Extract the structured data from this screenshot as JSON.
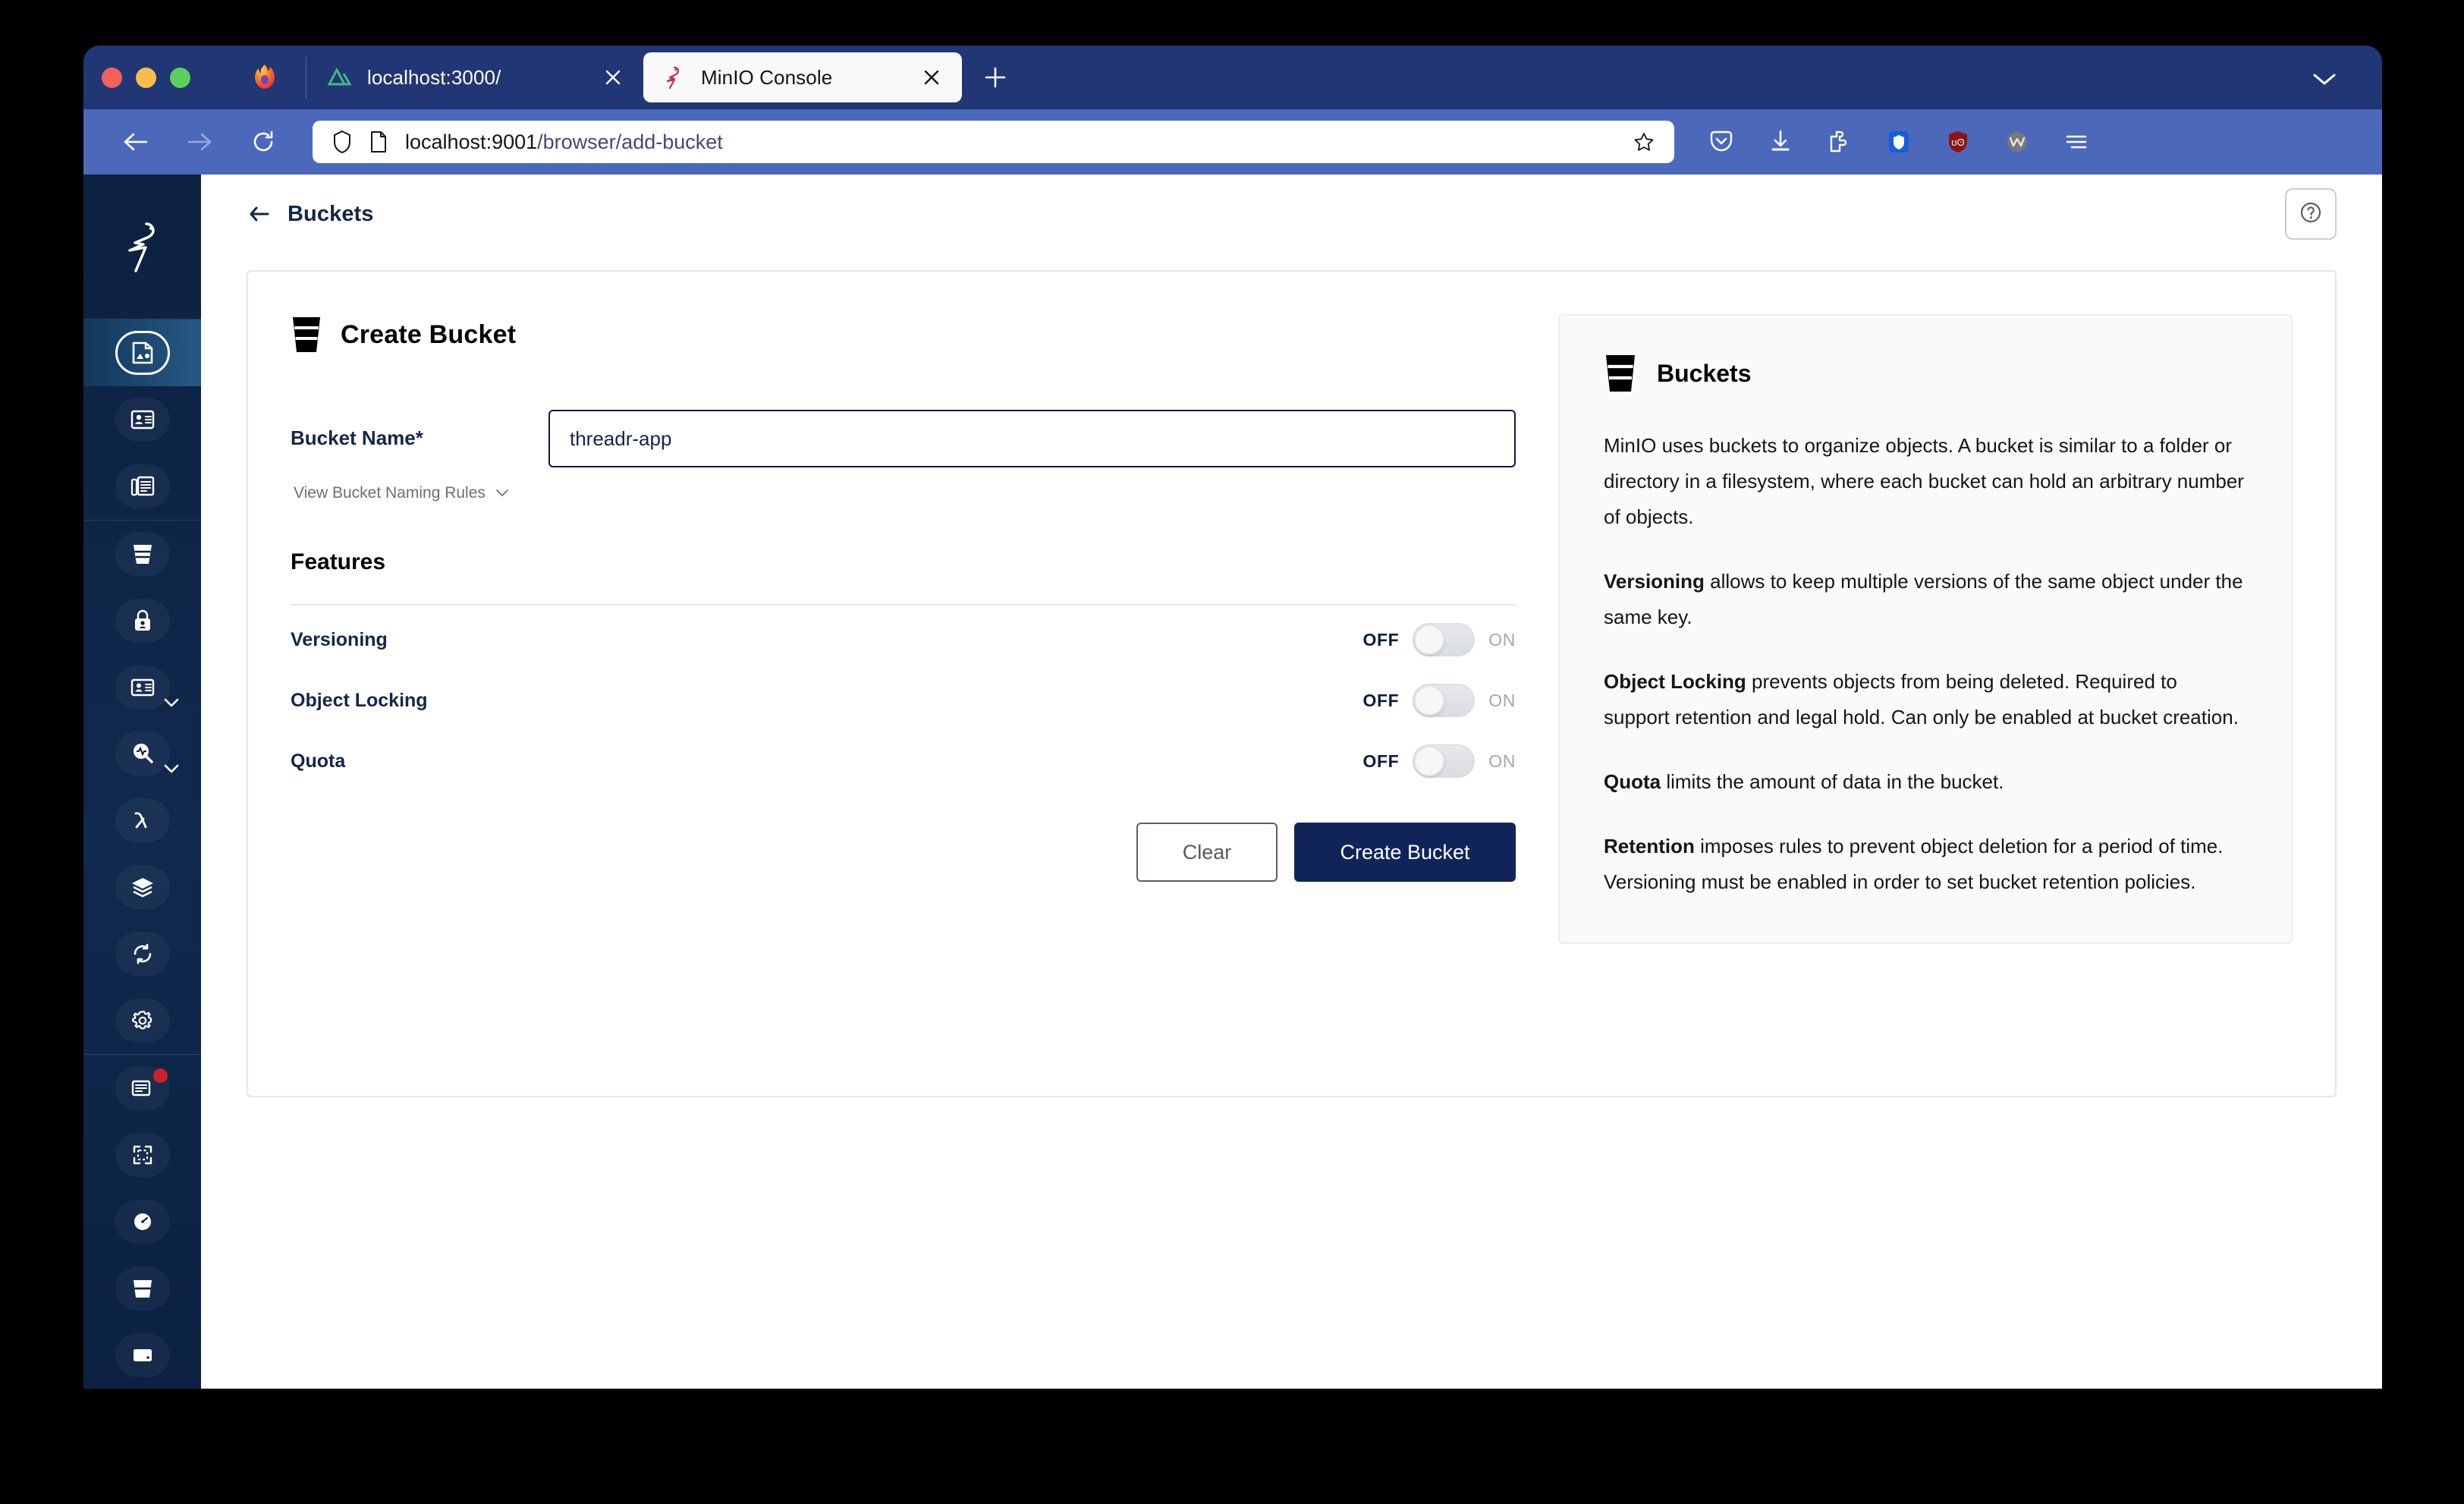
{
  "browser": {
    "app_icon": "firefox-icon",
    "tabs": [
      {
        "favicon": "nuxt-icon",
        "title": "localhost:3000/",
        "active": false
      },
      {
        "favicon": "minio-flamingo-icon",
        "title": "MinIO Console",
        "active": true
      }
    ],
    "new_tab_label": "+",
    "nav": {
      "back": "back-arrow-icon",
      "forward": "forward-arrow-icon",
      "reload": "reload-icon"
    },
    "url": {
      "host": "localhost:9001",
      "path": "/browser/add-bucket",
      "full": "localhost:9001/browser/add-bucket"
    },
    "toolbar_icons": [
      "pocket-icon",
      "downloads-icon",
      "extensions-puzzle-icon",
      "bitwarden-shield-icon",
      "ublock-origin-icon",
      "wallet-avatar-icon",
      "app-menu-icon"
    ]
  },
  "sidebar": {
    "logo": "minio-flamingo-logo",
    "items": [
      {
        "name": "object-browser",
        "icon": "object-browser-icon",
        "active": true,
        "caret": false,
        "badge": false
      },
      {
        "name": "access-keys",
        "icon": "id-card-icon",
        "active": false,
        "caret": false,
        "badge": false
      },
      {
        "name": "documentation",
        "icon": "documents-icon",
        "active": false,
        "caret": false,
        "badge": false
      },
      {
        "name": "buckets",
        "icon": "bucket-icon",
        "active": false,
        "caret": false,
        "badge": false
      },
      {
        "name": "identity",
        "icon": "lock-person-icon",
        "active": false,
        "caret": false,
        "badge": false
      },
      {
        "name": "users",
        "icon": "user-card-icon",
        "active": false,
        "caret": true,
        "badge": false
      },
      {
        "name": "monitoring",
        "icon": "monitoring-icon",
        "active": false,
        "caret": true,
        "badge": false
      },
      {
        "name": "events",
        "icon": "lambda-icon",
        "active": false,
        "caret": false,
        "badge": false
      },
      {
        "name": "tiering",
        "icon": "layers-icon",
        "active": false,
        "caret": false,
        "badge": false
      },
      {
        "name": "replication",
        "icon": "sync-icon",
        "active": false,
        "caret": false,
        "badge": false
      },
      {
        "name": "settings",
        "icon": "gear-icon",
        "active": false,
        "caret": false,
        "badge": false
      },
      {
        "name": "license",
        "icon": "news-icon",
        "active": false,
        "caret": false,
        "badge": true
      },
      {
        "name": "register",
        "icon": "dashed-box-icon",
        "active": false,
        "caret": false,
        "badge": false
      },
      {
        "name": "performance",
        "icon": "speedometer-icon",
        "active": false,
        "caret": false,
        "badge": false
      },
      {
        "name": "bucket-alt",
        "icon": "bucket-icon",
        "active": false,
        "caret": false,
        "badge": false
      },
      {
        "name": "drives",
        "icon": "drive-icon",
        "active": false,
        "caret": false,
        "badge": false
      }
    ]
  },
  "header": {
    "back_label": "Buckets",
    "back_icon": "back-arrow-icon",
    "help_icon": "help-circle-icon"
  },
  "form": {
    "icon": "bucket-icon",
    "title": "Create Bucket",
    "bucket_name_label": "Bucket Name*",
    "bucket_name_value": "threadr-app",
    "bucket_name_placeholder": "",
    "naming_rules_label": "View Bucket Naming Rules",
    "naming_rules_caret": "chevron-down-icon",
    "features_title": "Features",
    "features": [
      {
        "label": "Versioning",
        "off_label": "OFF",
        "on_label": "ON",
        "state": "off"
      },
      {
        "label": "Object Locking",
        "off_label": "OFF",
        "on_label": "ON",
        "state": "off"
      },
      {
        "label": "Quota",
        "off_label": "OFF",
        "on_label": "ON",
        "state": "off"
      }
    ],
    "clear_label": "Clear",
    "create_label": "Create Bucket"
  },
  "info_panel": {
    "icon": "bucket-icon",
    "title": "Buckets",
    "paragraphs": [
      {
        "bold": "",
        "text": "MinIO uses buckets to organize objects. A bucket is similar to a folder or directory in a filesystem, where each bucket can hold an arbitrary number of objects."
      },
      {
        "bold": "Versioning",
        "text": " allows to keep multiple versions of the same object under the same key."
      },
      {
        "bold": "Object Locking",
        "text": " prevents objects from being deleted. Required to support retention and legal hold. Can only be enabled at bucket creation."
      },
      {
        "bold": "Quota",
        "text": " limits the amount of data in the bucket."
      },
      {
        "bold": "Retention",
        "text": " imposes rules to prevent object deletion for a period of time. Versioning must be enabled in order to set bucket retention policies."
      }
    ]
  },
  "colors": {
    "window_chrome": "#203675",
    "nav_bar": "#4c68bb",
    "sidebar_dark": "#0d2141",
    "sidebar_active": "#255a85",
    "accent_navy": "#11245a",
    "text_navy": "#14264a",
    "badge_red": "#c8232c"
  }
}
